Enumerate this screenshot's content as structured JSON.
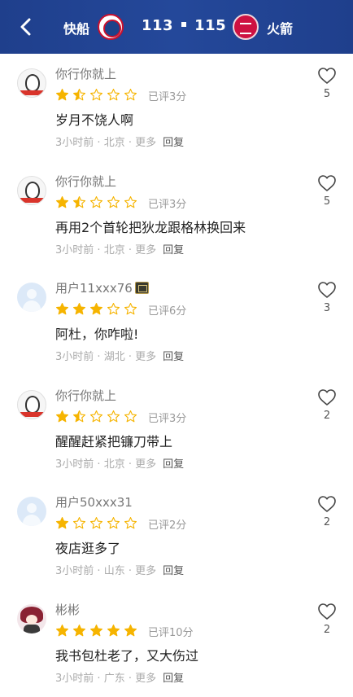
{
  "header": {
    "team_left": "快船",
    "team_right": "火箭",
    "score_left": "113",
    "score_right": "115"
  },
  "comments": [
    {
      "user": "你行你就上",
      "avatar": "penguin-avatar",
      "badge": false,
      "rating": 1.5,
      "rating_text": "已评3分",
      "content": "岁月不饶人啊",
      "time": "3小时前",
      "location": "北京",
      "more": "更多",
      "reply": "回复",
      "likes": "5"
    },
    {
      "user": "你行你就上",
      "avatar": "penguin-avatar",
      "badge": false,
      "rating": 1.5,
      "rating_text": "已评3分",
      "content": "再用2个首轮把狄龙跟格林换回来",
      "time": "3小时前",
      "location": "北京",
      "more": "更多",
      "reply": "回复",
      "likes": "5"
    },
    {
      "user": "用户11xxx76",
      "avatar": "default-avatar",
      "badge": true,
      "rating": 3,
      "rating_text": "已评6分",
      "content": "阿杜，你咋啦!",
      "time": "3小时前",
      "location": "湖北",
      "more": "更多",
      "reply": "回复",
      "likes": "3"
    },
    {
      "user": "你行你就上",
      "avatar": "penguin-avatar",
      "badge": false,
      "rating": 1.5,
      "rating_text": "已评3分",
      "content": "醒醒赶紧把镰刀带上",
      "time": "3小时前",
      "location": "北京",
      "more": "更多",
      "reply": "回复",
      "likes": "2"
    },
    {
      "user": "用户50xxx31",
      "avatar": "default-avatar",
      "badge": false,
      "rating": 1,
      "rating_text": "已评2分",
      "content": "夜店逛多了",
      "time": "3小时前",
      "location": "山东",
      "more": "更多",
      "reply": "回复",
      "likes": "2"
    },
    {
      "user": "彬彬",
      "avatar": "anime-avatar",
      "badge": false,
      "rating": 5,
      "rating_text": "已评10分",
      "content": "我书包杜老了，又大伤过",
      "time": "3小时前",
      "location": "广东",
      "more": "更多",
      "reply": "回复",
      "likes": "2"
    }
  ],
  "colors": {
    "header_bg": "#24489a",
    "star_filled": "#f6b400",
    "star_empty_stroke": "#f6b400"
  }
}
